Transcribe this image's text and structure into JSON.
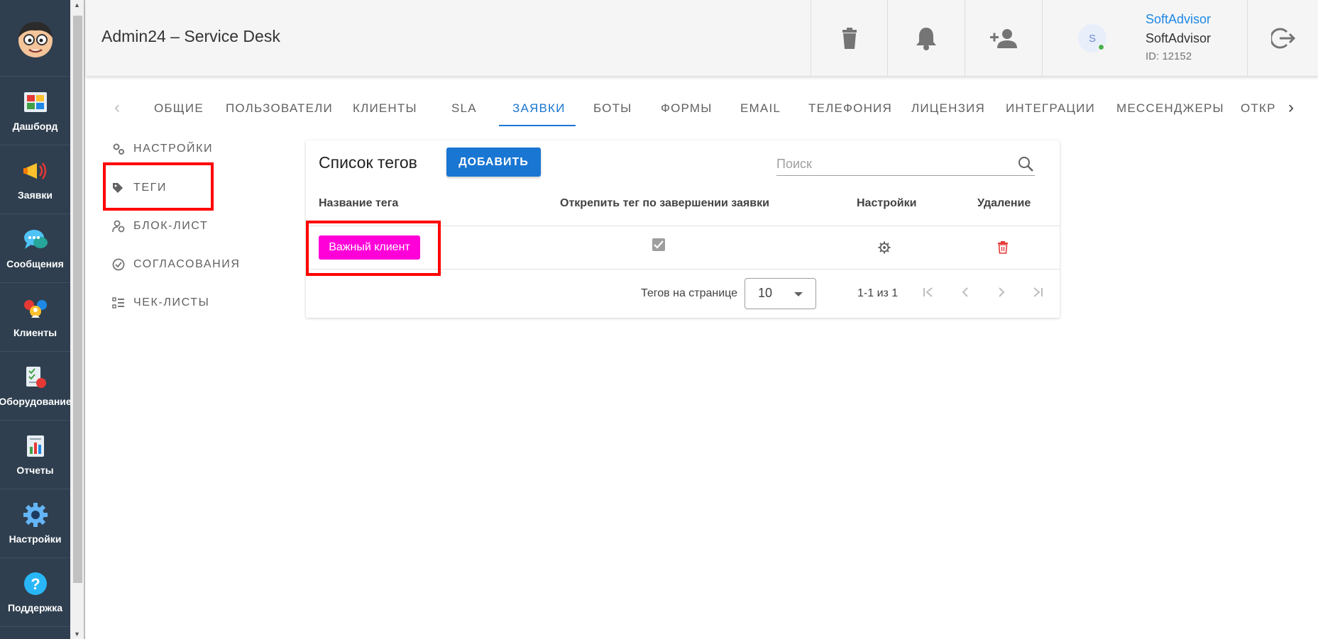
{
  "app": {
    "title": "Admin24 – Service Desk"
  },
  "sidebar": {
    "items": [
      {
        "label": "Дашборд",
        "icon": "dashboard-icon"
      },
      {
        "label": "Заявки",
        "icon": "megaphone-icon"
      },
      {
        "label": "Сообщения",
        "icon": "chat-bubbles-icon"
      },
      {
        "label": "Клиенты",
        "icon": "clients-icon"
      },
      {
        "label": "Оборудование",
        "icon": "equipment-icon"
      },
      {
        "label": "Отчеты",
        "icon": "report-icon"
      },
      {
        "label": "Настройки",
        "icon": "gear-icon"
      },
      {
        "label": "Поддержка",
        "icon": "help-icon"
      }
    ]
  },
  "header": {
    "user": {
      "link": "SoftAdvisor",
      "name": "SoftAdvisor",
      "id": "ID: 12152",
      "avatar_initial": "S",
      "status_color": "#4caf50"
    }
  },
  "tabs": {
    "items": [
      "ОБЩИЕ",
      "ПОЛЬЗОВАТЕЛИ",
      "КЛИЕНТЫ",
      "SLA",
      "ЗАЯВКИ",
      "БОТЫ",
      "ФОРМЫ",
      "EMAIL",
      "ТЕЛЕФОНИЯ",
      "ЛИЦЕНЗИЯ",
      "ИНТЕГРАЦИИ",
      "МЕССЕНДЖЕРЫ",
      "ОТКР"
    ],
    "active": "ЗАЯВКИ"
  },
  "settings_menu": {
    "items": [
      "НАСТРОЙКИ",
      "ТЕГИ",
      "БЛОК-ЛИСТ",
      "СОГЛАСОВАНИЯ",
      "ЧЕК-ЛИСТЫ"
    ],
    "active": "ТЕГИ"
  },
  "tags_card": {
    "title": "Список тегов",
    "add_label": "ДОБАВИТЬ",
    "search_placeholder": "Поиск",
    "columns": [
      "Название тега",
      "Открепить тег по завершении заявки",
      "Настройки",
      "Удаление"
    ],
    "rows": [
      {
        "name": "Важный клиент",
        "color": "#ff00d9",
        "unpin_on_close": true
      }
    ],
    "pagination": {
      "per_page_label": "Тегов на странице",
      "per_page": "10",
      "range": "1-1 из 1"
    }
  },
  "colors": {
    "accent": "#1976d2",
    "sidebar_bg": "#2f3f4f",
    "highlight": "#ff0000",
    "delete": "#e53935"
  }
}
